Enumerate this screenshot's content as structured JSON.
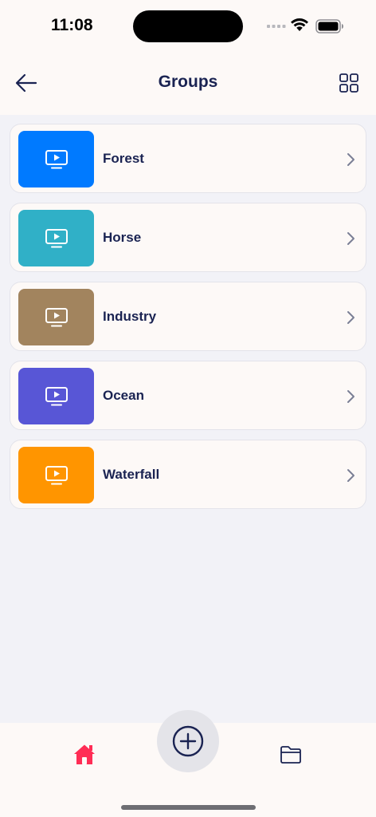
{
  "status_bar": {
    "time": "11:08",
    "icons": [
      "cellular-signal-icon",
      "wifi-icon",
      "battery-icon"
    ]
  },
  "header": {
    "title": "Groups",
    "back_icon": "arrow-left-icon",
    "layout_icon": "grid-icon"
  },
  "groups": [
    {
      "label": "Forest",
      "color": "#007aff",
      "icon": "tv-play-icon"
    },
    {
      "label": "Horse",
      "color": "#30b0c7",
      "icon": "tv-play-icon"
    },
    {
      "label": "Industry",
      "color": "#a2845e",
      "icon": "tv-play-icon"
    },
    {
      "label": "Ocean",
      "color": "#5856d6",
      "icon": "tv-play-icon"
    },
    {
      "label": "Waterfall",
      "color": "#ff9500",
      "icon": "tv-play-icon"
    }
  ],
  "colors": {
    "text_primary": "#1a2352",
    "accent_home": "#ff2d55",
    "background": "#f2f2f7",
    "surface": "#fdf9f7"
  },
  "tab_bar": {
    "home_icon": "home-icon",
    "add_icon": "plus-circle-icon",
    "folder_icon": "folder-icon"
  }
}
